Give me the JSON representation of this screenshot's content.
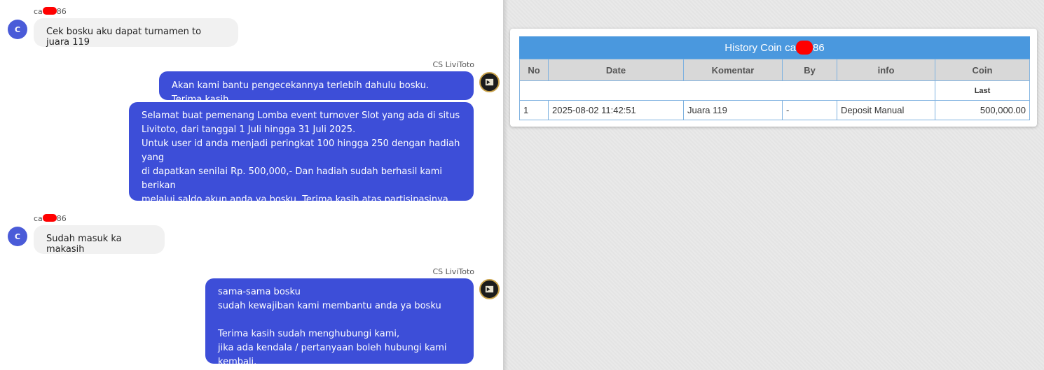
{
  "chat": {
    "messages": [
      {
        "sender_prefix": "ca",
        "sender_suffix": "86",
        "avatar": "C",
        "text": "Cek bosku aku dapat turnamen to juara 119"
      },
      {
        "sender": "CS LiviToto",
        "text": "Akan kami bantu pengecekannya terlebih dahulu bosku. Terima kasih"
      },
      {
        "text": "Selamat buat pemenang Lomba event turnover Slot yang ada di situs\nLivitoto, dari tanggal 1 Juli hingga 31 Juli 2025.\nUntuk user id anda menjadi peringkat 100 hingga 250 dengan hadiah yang\ndi dapatkan senilai Rp. 500,000,- Dan hadiah sudah berhasil kami berikan\nmelalui saldo akun anda ya bosku, Terima kasih atas partisipasinya, dan\nsampai jumpa di event selanjutnya, ya bosku"
      },
      {
        "sender_prefix": "ca",
        "sender_suffix": "86",
        "avatar": "C",
        "text": "Sudah masuk ka makasih"
      },
      {
        "sender": "CS LiviToto",
        "text": "sama-sama bosku\nsudah kewajiban kami membantu anda ya bosku\n\nTerima kasih sudah menghubungi kami,\njika ada kendala / pertanyaan boleh hubungi kami kembali."
      }
    ]
  },
  "history": {
    "title_prefix": "History Coin ca",
    "title_suffix": "86",
    "columns": [
      "No",
      "Date",
      "Komentar",
      "By",
      "info",
      "Coin"
    ],
    "last_label": "Last",
    "rows": [
      {
        "no": "1",
        "date": "2025-08-02 11:42:51",
        "komentar": "Juara 119",
        "by": "-",
        "info": "Deposit Manual",
        "coin": "500,000.00"
      }
    ]
  },
  "colors": {
    "user_bubble": "#f1f1f1",
    "agent_bubble": "#3d4ed8",
    "table_header": "#4a98de",
    "coin_value": "#2e8b3e",
    "redaction": "#ff0000"
  }
}
